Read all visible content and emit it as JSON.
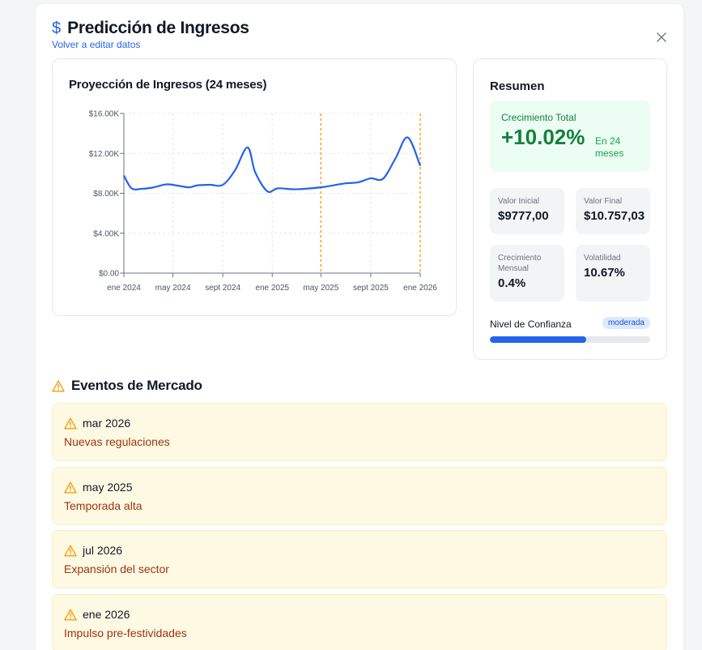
{
  "header": {
    "title": "Predicción de Ingresos",
    "back_link": "Volver a editar datos",
    "dollar_icon": "$"
  },
  "chart": {
    "title": "Proyección de Ingresos (24 meses)"
  },
  "chart_data": {
    "type": "line",
    "title": "Proyección de Ingresos (24 meses)",
    "xlabel": "",
    "ylabel": "",
    "x_range": [
      "2024-01",
      "2026-01"
    ],
    "ylim": [
      0,
      16000
    ],
    "y_ticks": [
      "$0.00",
      "$4.00K",
      "$8.00K",
      "$12.00K",
      "$16.00K"
    ],
    "x_ticks": [
      "ene 2024",
      "may 2024",
      "sept 2024",
      "ene 2025",
      "may 2025",
      "sept 2025",
      "ene 2026"
    ],
    "grid": true,
    "series": [
      {
        "color": "#2563eb",
        "points": [
          [
            "2024-01-01",
            9777
          ],
          [
            "2024-01-20",
            8500
          ],
          [
            "2024-02-15",
            8450
          ],
          [
            "2024-03-15",
            8600
          ],
          [
            "2024-04-15",
            8900
          ],
          [
            "2024-05-15",
            8750
          ],
          [
            "2024-06-10",
            8600
          ],
          [
            "2024-07-01",
            8800
          ],
          [
            "2024-08-01",
            8850
          ],
          [
            "2024-09-01",
            8850
          ],
          [
            "2024-10-01",
            10300
          ],
          [
            "2024-11-01",
            12600
          ],
          [
            "2024-11-20",
            10100
          ],
          [
            "2024-12-20",
            8200
          ],
          [
            "2025-01-15",
            8500
          ],
          [
            "2025-03-01",
            8400
          ],
          [
            "2025-05-01",
            8600
          ],
          [
            "2025-06-01",
            8800
          ],
          [
            "2025-07-01",
            9000
          ],
          [
            "2025-08-01",
            9100
          ],
          [
            "2025-09-01",
            9500
          ],
          [
            "2025-10-01",
            9450
          ],
          [
            "2025-11-01",
            11500
          ],
          [
            "2025-12-01",
            13600
          ],
          [
            "2026-01-01",
            10757
          ]
        ]
      }
    ],
    "markers": [
      "2025-05-01",
      "2026-01-01"
    ],
    "marker_color": "#f59e0b"
  },
  "summary": {
    "title": "Resumen",
    "growth_label": "Crecimiento Total",
    "growth_value": "+10.02%",
    "growth_sub": "En 24 meses",
    "initial_label": "Valor Inicial",
    "initial_value": "$9777,00",
    "final_label": "Valor Final",
    "final_value": "$10.757,03",
    "monthly_label": "Crecimiento Mensual",
    "monthly_value": "0.4%",
    "volatility_label": "Volatilidad",
    "volatility_value": "10.67%",
    "confidence_label": "Nivel de Confianza",
    "confidence_badge": "moderada",
    "confidence_level": 0.6
  },
  "events": {
    "title": "Eventos de Mercado",
    "items": [
      {
        "date": "mar 2026",
        "desc": "Nuevas regulaciones"
      },
      {
        "date": "may 2025",
        "desc": "Temporada alta"
      },
      {
        "date": "jul 2026",
        "desc": "Expansión del sector"
      },
      {
        "date": "ene 2026",
        "desc": "Impulso pre-festividades"
      }
    ]
  },
  "colors": {
    "accent": "#2563eb",
    "growth": "#15803d",
    "warning": "#f59e0b",
    "event_text": "#9a3412"
  }
}
